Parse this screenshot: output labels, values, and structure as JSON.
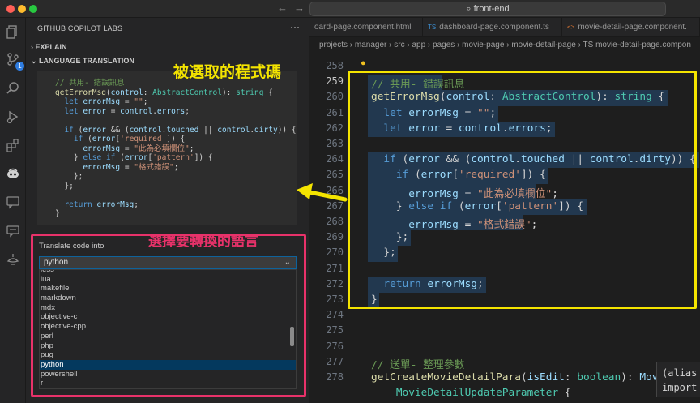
{
  "window": {
    "title": "front-end",
    "colors": {
      "accent": "#2f7de1",
      "annotation_yellow": "#f4e400",
      "annotation_pink": "#e8326a"
    }
  },
  "titlebar": {
    "nav_back_icon": "arrow-left-icon",
    "nav_forward_icon": "arrow-right-icon",
    "search_icon": "search-icon"
  },
  "activity_bar": {
    "items": [
      {
        "name": "files-icon"
      },
      {
        "name": "source-control-icon",
        "badge": "1"
      },
      {
        "name": "search-icon"
      },
      {
        "name": "run-debug-icon"
      },
      {
        "name": "extensions-icon"
      },
      {
        "name": "copilot-icon"
      },
      {
        "name": "chat-icon"
      },
      {
        "name": "comments-icon"
      },
      {
        "name": "labs-icon"
      }
    ]
  },
  "sidebar": {
    "title": "GITHUB COPILOT LABS",
    "more": "···",
    "sections": {
      "explain": "EXPLAIN",
      "translation": "LANGUAGE TRANSLATION"
    },
    "code_lines": [
      "// 共用- 錯誤訊息",
      "getErrorMsg(control: AbstractControl): string {",
      "  let errorMsg = \"\";",
      "  let error = control.errors;",
      "",
      "  if (error && (control.touched || control.dirty)) {",
      "    if (error['required']) {",
      "      errorMsg = \"此為必填欄位\";",
      "    } else if (error['pattern']) {",
      "      errorMsg = \"格式錯誤\";",
      "    };",
      "  };",
      "",
      "  return errorMsg;",
      "}"
    ],
    "translate_label": "Translate code into",
    "selected_language": "python",
    "languages": [
      "less",
      "lua",
      "makefile",
      "markdown",
      "mdx",
      "objective-c",
      "objective-cpp",
      "perl",
      "php",
      "pug",
      "python",
      "powershell",
      "r"
    ]
  },
  "tabs": [
    {
      "label": "oard-page.component.html",
      "kind": "html"
    },
    {
      "label": "dashboard-page.component.ts",
      "kind": "ts"
    },
    {
      "label": "movie-detail-page.component.",
      "kind": "html"
    }
  ],
  "breadcrumb": "projects › manager › src › app › pages › movie-page › movie-detail-page › TS movie-detail-page.compon",
  "editor": {
    "line_numbers": [
      "258",
      "259",
      "260",
      "261",
      "262",
      "263",
      "264",
      "265",
      "266",
      "267",
      "268",
      "269",
      "270",
      "271",
      "272",
      "273",
      "274",
      "275",
      "276",
      "277",
      "278",
      ""
    ],
    "current_line": "259",
    "code_tail": [
      "// 送單- 整理參數",
      "getCreateMovieDetailPara(isEdit: boolean): Movi",
      "    MovieDetailUpdateParameter {"
    ],
    "hover_lines": [
      "(alias",
      "import"
    ]
  },
  "annotations": {
    "selected_code": "被選取的程式碼",
    "choose_language": "選擇要轉換的語言"
  }
}
